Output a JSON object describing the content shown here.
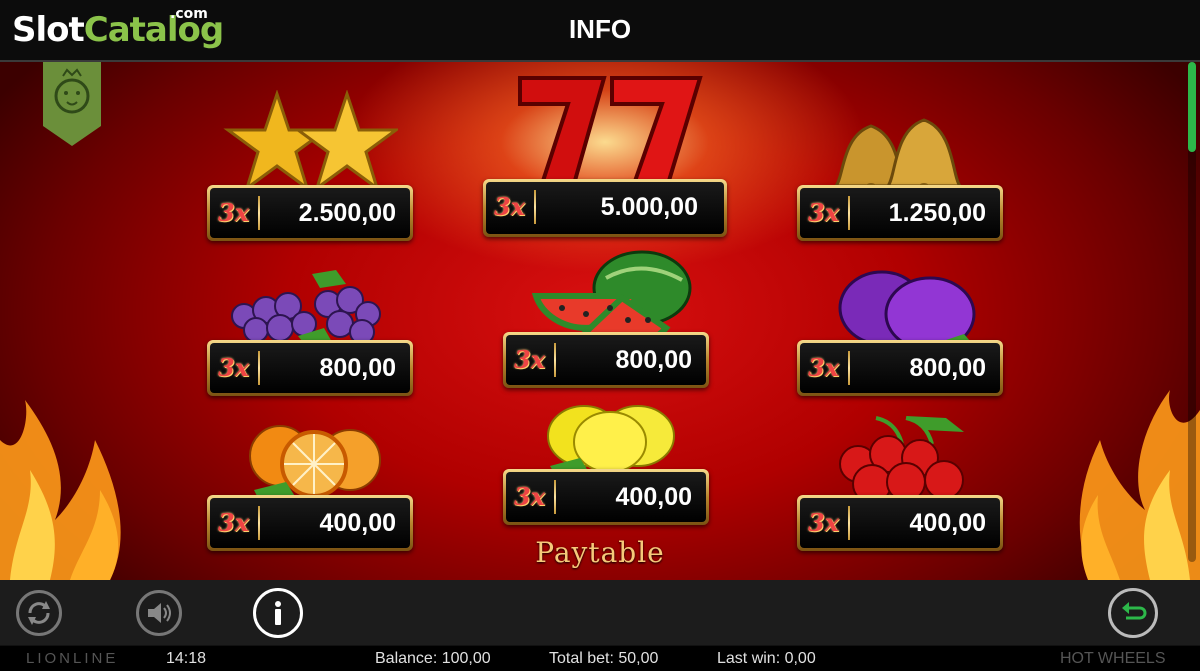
{
  "header": {
    "logo_slot": "Slot",
    "logo_catalog": "Catalog",
    "logo_com": ".com",
    "title": "INFO"
  },
  "paytable": {
    "heading": "Paytable",
    "items": [
      {
        "symbol": "star-icon",
        "multiplier": "3x",
        "value": "2.500,00"
      },
      {
        "symbol": "seven-icon",
        "multiplier": "3x",
        "value": "5.000,00"
      },
      {
        "symbol": "bell-icon",
        "multiplier": "3x",
        "value": "1.250,00"
      },
      {
        "symbol": "grapes-icon",
        "multiplier": "3x",
        "value": "800,00"
      },
      {
        "symbol": "watermelon-icon",
        "multiplier": "3x",
        "value": "800,00"
      },
      {
        "symbol": "plum-icon",
        "multiplier": "3x",
        "value": "800,00"
      },
      {
        "symbol": "orange-icon",
        "multiplier": "3x",
        "value": "400,00"
      },
      {
        "symbol": "lemon-icon",
        "multiplier": "3x",
        "value": "400,00"
      },
      {
        "symbol": "cherry-icon",
        "multiplier": "3x",
        "value": "400,00"
      }
    ]
  },
  "status_bar": {
    "brand": "LIONLINE",
    "time": "14:18",
    "balance": "Balance: 100,00",
    "total_bet": "Total bet: 50,00",
    "last_win": "Last win: 0,00",
    "game_name": "HOT WHEELS"
  },
  "colors": {
    "accent_green": "#2db84a",
    "background_red": "#b00000",
    "gold": "#d4a64a"
  }
}
